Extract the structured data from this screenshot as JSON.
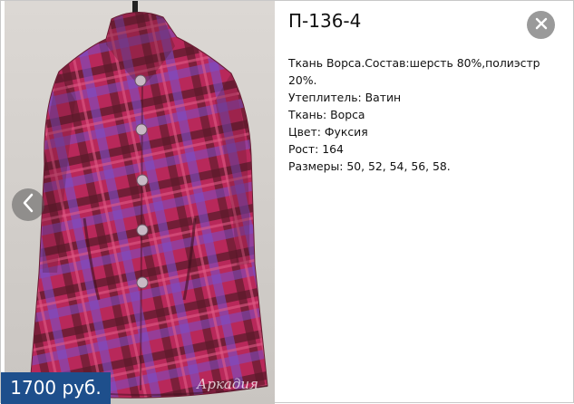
{
  "product": {
    "code": "П-136-4",
    "price": "1700 руб.",
    "watermark": "Аркадия",
    "description": {
      "composition": "Ткань Ворса.Состав:шерсть 80%,полиэстр 20%.",
      "insulation": "Утеплитель: Ватин",
      "fabric": "Ткань: Ворса",
      "color": "Цвет: Фуксия",
      "height": "Рост: 164",
      "sizes": "Размеры: 50, 52, 54, 56, 58."
    }
  },
  "icons": {
    "prev": "chevron-left-icon",
    "close": "close-icon"
  },
  "colors": {
    "price_bg": "#1e4f8c",
    "coat_base": "#b8285a",
    "coat_dark": "#5a1a2a",
    "coat_violet": "#7a4fc8"
  }
}
